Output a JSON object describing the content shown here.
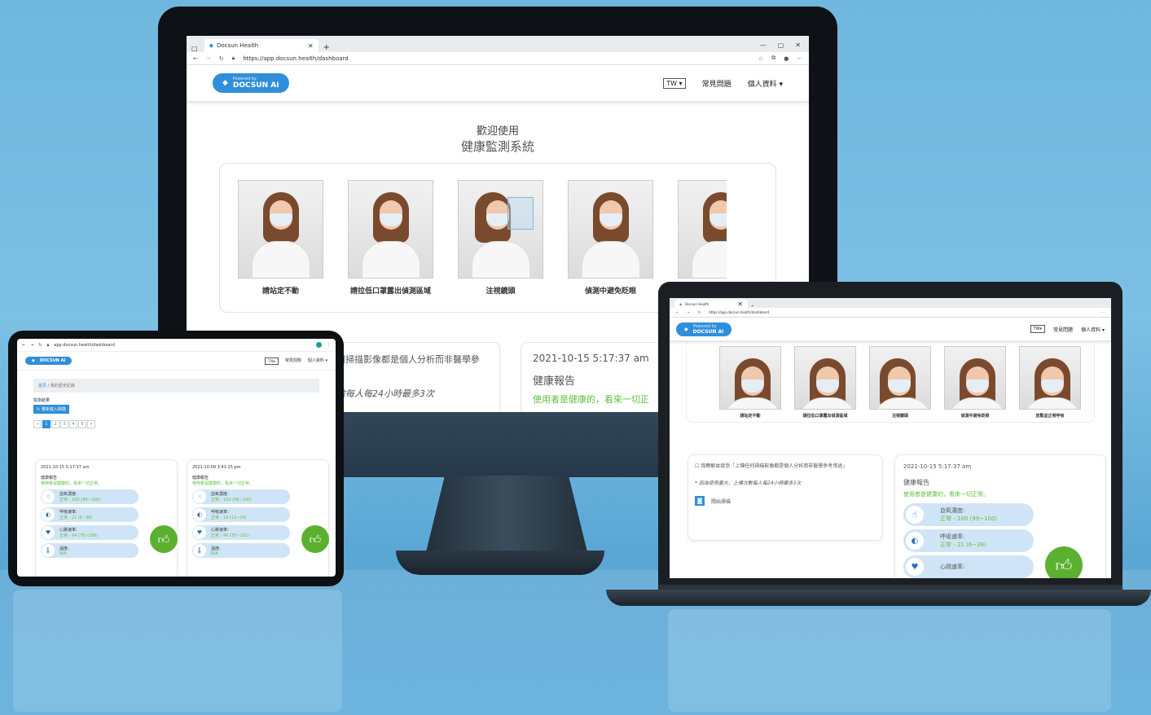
{
  "browser": {
    "tab_title": "Docsun Health",
    "url": "https://app.docsun.health/dashboard",
    "tablet_url": "app.docsun.health/dashboard"
  },
  "brand": {
    "powered": "Powered by",
    "name": "DOCSUN AI",
    "color": "#2f8fdb"
  },
  "nav": {
    "lang": "TW",
    "faq": "常見問題",
    "profile": "個人資料"
  },
  "welcome": {
    "line1": "歡迎使用",
    "line2": "健康監測系統"
  },
  "guides": [
    {
      "label": "請站定不動"
    },
    {
      "label": "請拉低口罩露出偵測區域"
    },
    {
      "label": "注視鏡頭"
    },
    {
      "label": "偵測中避免眨眼"
    },
    {
      "label": "放鬆並正常呼吸"
    }
  ],
  "consent": {
    "text": "我瞭解並接受「上傳任何掃描影像都是個人分析而非醫學參考用途」",
    "note": "* 因為使用量大，上傳次數每人每24小時最多3次",
    "scan_button": "開始掃描"
  },
  "monitor_consent_fragment": "何掃描影像都是個人分析而非醫學參",
  "monitor_note_fragment": "數每人每24小時最多3次",
  "report": {
    "time": "2021-10-15 5:17:37 am",
    "title": "健康報告",
    "status": "使用者是健康的，看來一切正常。",
    "monitor_status_fragment": "使用者是健康的，看來一切正",
    "metrics": [
      {
        "name": "血氧濃度:",
        "value": "正常 - 100 (99~100)"
      },
      {
        "name": "呼吸速率:",
        "value": "正常 - 21 (6~38)"
      },
      {
        "name": "心跳速率:",
        "value": "正常 - 94 (76~106)"
      },
      {
        "name": "溫度:",
        "value": "N/A"
      }
    ]
  },
  "history": {
    "breadcrumb_home": "首頁",
    "breadcrumb": "我的歷史紀錄",
    "section": "檢測結果",
    "rescan": "重新進入掃描",
    "pages": [
      "1",
      "2",
      "3",
      "4",
      "5"
    ],
    "second_time": "2021-10-09 3:41:15 pm",
    "second_metrics": [
      {
        "name": "血氧濃度:",
        "value": "正常 - 100 (98~100)"
      },
      {
        "name": "呼吸速率:",
        "value": "正常 - 14 (12~19)"
      },
      {
        "name": "心跳速率:",
        "value": "正常 - 90 (76~102)"
      },
      {
        "name": "溫度:",
        "value": "N/A"
      }
    ]
  }
}
